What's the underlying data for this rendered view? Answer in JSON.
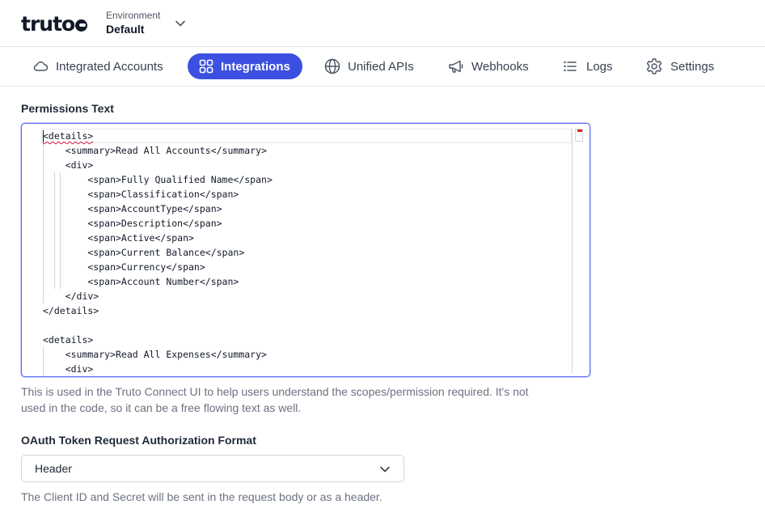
{
  "app": {
    "logo_text": "truto"
  },
  "environment": {
    "label": "Environment",
    "value": "Default"
  },
  "nav": {
    "tabs": [
      {
        "label": "Integrated Accounts",
        "icon": "cloud-icon",
        "active": false
      },
      {
        "label": "Integrations",
        "icon": "grid-icon",
        "active": true
      },
      {
        "label": "Unified APIs",
        "icon": "globe-icon",
        "active": false
      },
      {
        "label": "Webhooks",
        "icon": "megaphone-icon",
        "active": false
      },
      {
        "label": "Logs",
        "icon": "list-icon",
        "active": false
      },
      {
        "label": "Settings",
        "icon": "gear-icon",
        "active": false
      }
    ]
  },
  "permissions": {
    "label": "Permissions Text",
    "code_lines": [
      "<details>",
      "    <summary>Read All Accounts</summary>",
      "    <div>",
      "        <span>Fully Qualified Name</span>",
      "        <span>Classification</span>",
      "        <span>AccountType</span>",
      "        <span>Description</span>",
      "        <span>Active</span>",
      "        <span>Current Balance</span>",
      "        <span>Currency</span>",
      "        <span>Account Number</span>",
      "    </div>",
      "</details>",
      "",
      "<details>",
      "    <summary>Read All Expenses</summary>",
      "    <div>"
    ],
    "help_line1": "This is used in the Truto Connect UI to help users understand the scopes/permission required. It's not",
    "help_line2": "used in the code, so it can be a free flowing text as well."
  },
  "oauth": {
    "label": "OAuth Token Request Authorization Format",
    "selected": "Header",
    "help": "The Client ID and Secret will be sent in the request body or as a header."
  },
  "colors": {
    "accent": "#3b50e0",
    "text": "#1f2937",
    "muted": "#6b7280",
    "border": "#e5e7eb"
  }
}
